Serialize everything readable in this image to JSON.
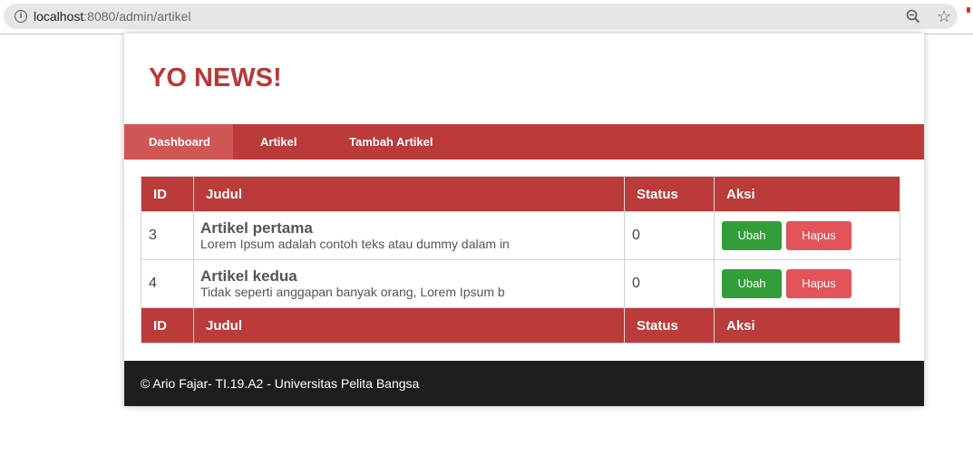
{
  "browser": {
    "url_host": "localhost",
    "url_rest": ":8080/admin/artikel",
    "info_icon": "info-icon",
    "zoom_icon": "zoom-out-icon",
    "bookmark_icon": "star-icon"
  },
  "site": {
    "title": "YO NEWS!",
    "brand_color": "#bb3a3a"
  },
  "nav": {
    "items": [
      {
        "label": "Dashboard",
        "active": true
      },
      {
        "label": "Artikel",
        "active": false
      },
      {
        "label": "Tambah Artikel",
        "active": false
      }
    ]
  },
  "table": {
    "headers": [
      "ID",
      "Judul",
      "Status",
      "Aksi"
    ],
    "footer_headers": [
      "ID",
      "Judul",
      "Status",
      "Aksi"
    ],
    "rows": [
      {
        "id": "3",
        "title": "Artikel pertama",
        "excerpt": "Lorem Ipsum adalah contoh teks atau dummy dalam in",
        "status": "0",
        "edit_label": "Ubah",
        "delete_label": "Hapus"
      },
      {
        "id": "4",
        "title": "Artikel kedua",
        "excerpt": "Tidak seperti anggapan banyak orang, Lorem Ipsum b",
        "status": "0",
        "edit_label": "Ubah",
        "delete_label": "Hapus"
      }
    ]
  },
  "colors": {
    "edit_button": "#339d3a",
    "delete_button": "#e2535a",
    "footer_bg": "#1e1e1e"
  },
  "footer": {
    "text": "© Ario Fajar- TI.19.A2 - Universitas Pelita Bangsa"
  }
}
